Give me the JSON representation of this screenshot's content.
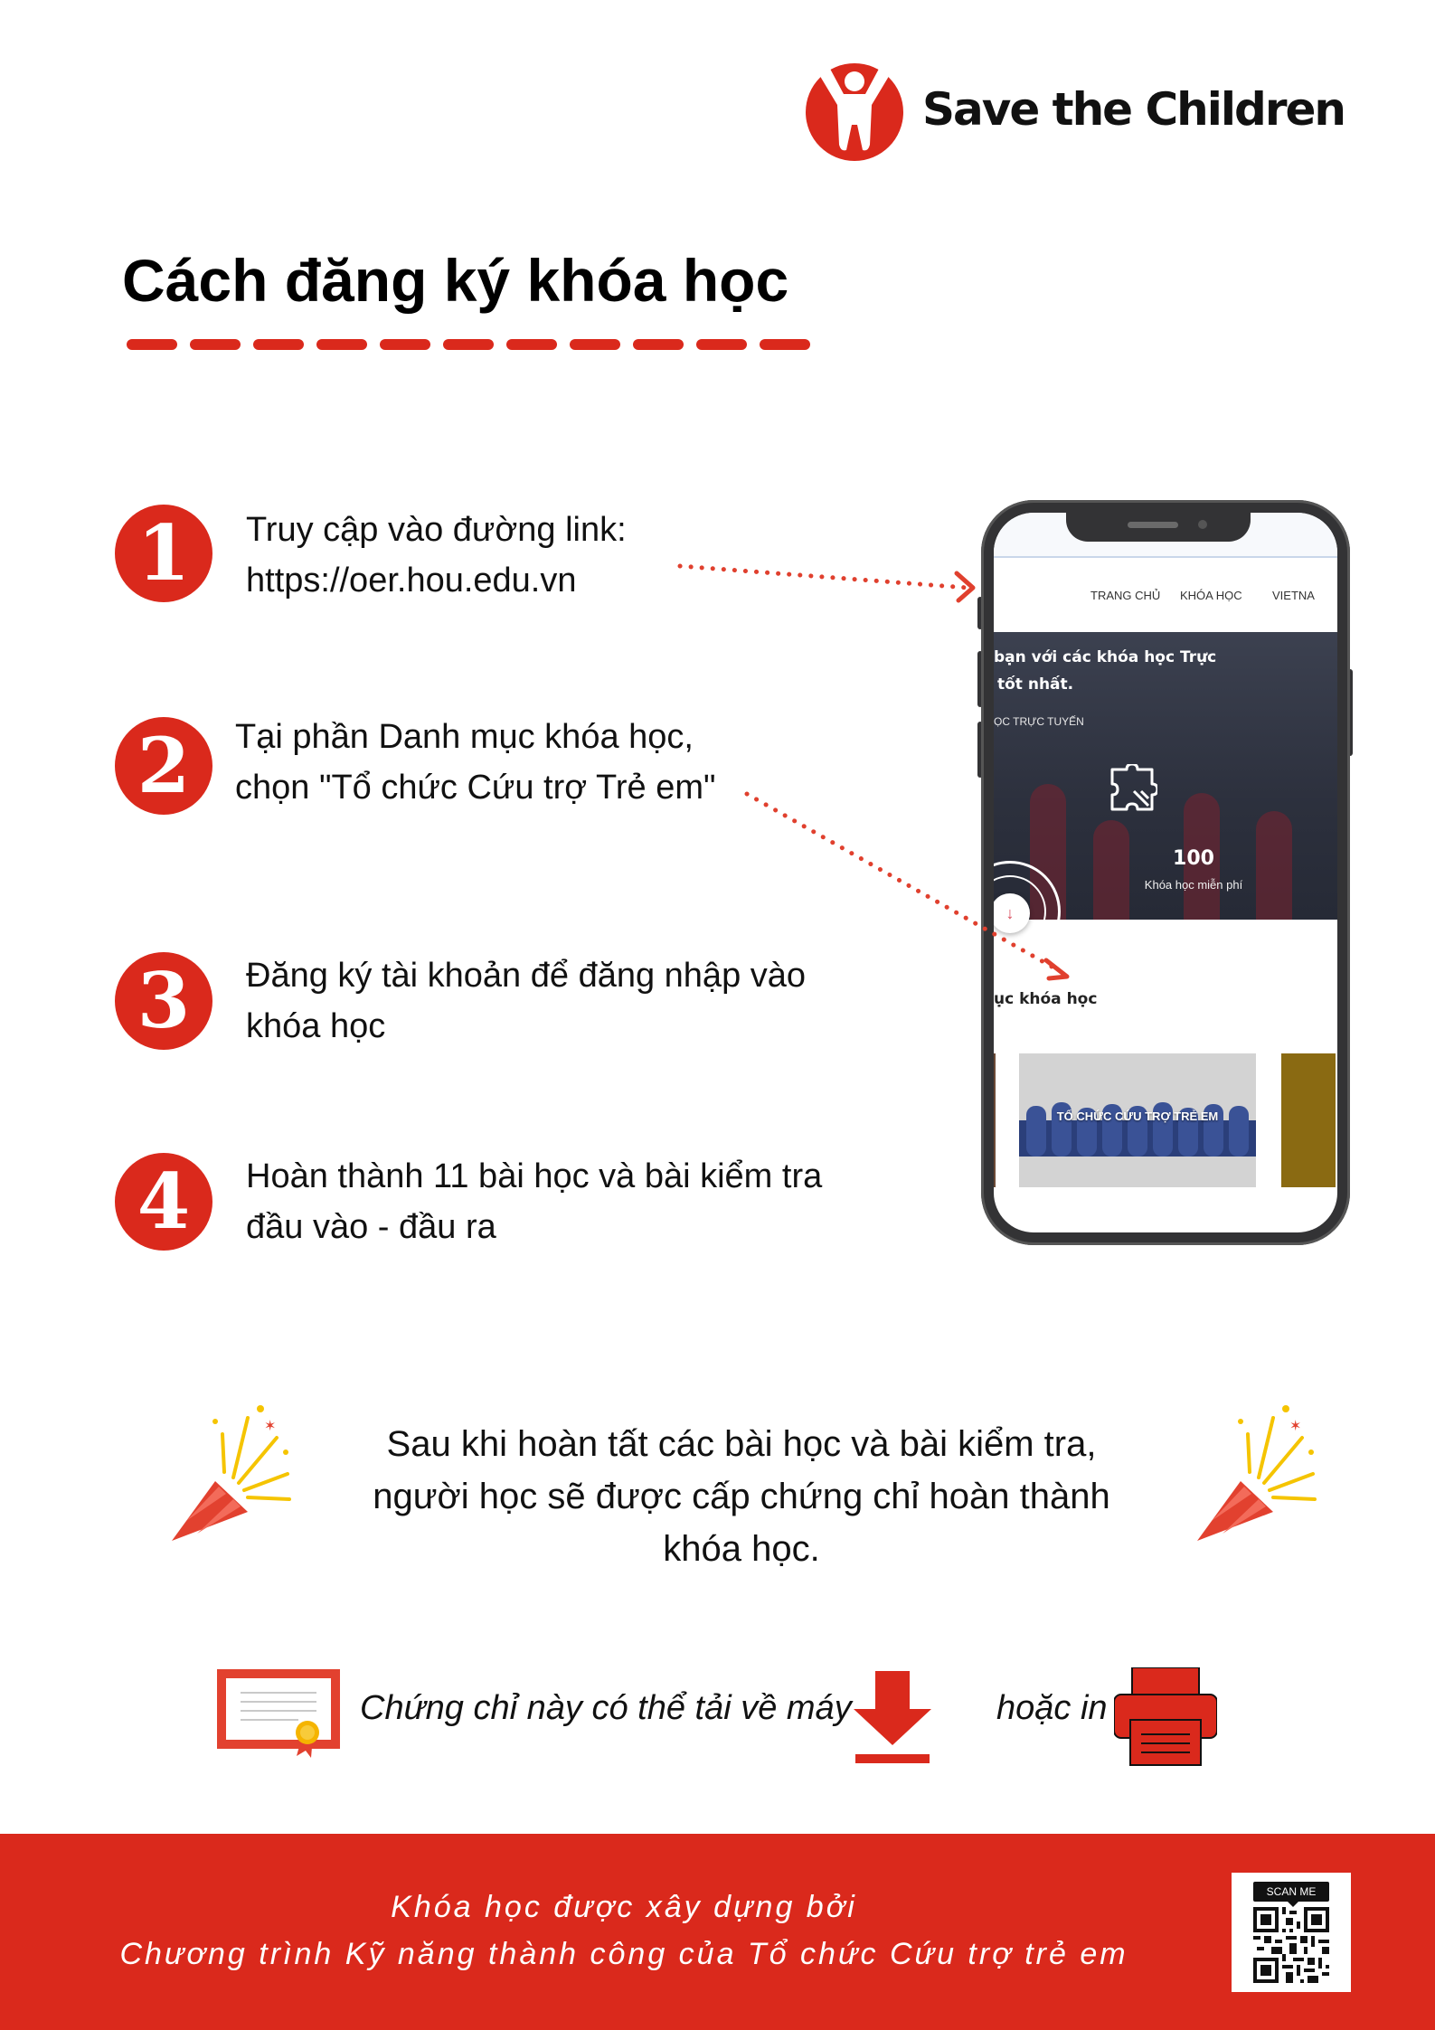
{
  "brand": {
    "name": "Save the Children",
    "color": "#da291c"
  },
  "title": "Cách đăng ký khóa học",
  "steps": [
    {
      "number": "1",
      "lines": [
        "Truy cập vào đường link:",
        "https://oer.hou.edu.vn"
      ]
    },
    {
      "number": "2",
      "lines": [
        "Tại phần Danh mục khóa học,",
        "chọn \"Tổ chức Cứu trợ Trẻ em\""
      ]
    },
    {
      "number": "3",
      "lines": [
        "Đăng ký tài khoản để đăng nhập vào",
        "khóa học"
      ]
    },
    {
      "number": "4",
      "lines": [
        "Hoàn thành 11 bài học và bài kiểm tra",
        "đầu vào - đầu ra"
      ]
    }
  ],
  "phone": {
    "nav": [
      "TRANG CHỦ",
      "KHÓA HỌC",
      "VIETNA"
    ],
    "hero_line1": "bạn với các khóa học Trực",
    "hero_line2": "tốt nhất.",
    "hero_sub": "ỌC TRỰC TUYẾN",
    "stat_value": "100",
    "stat_label": "Khóa học miễn phí",
    "scroll_arrow": "↓",
    "category_title": "ục khóa học",
    "card_label": "TỔ CHỨC CỨU TRỢ TRẺ EM"
  },
  "completion": {
    "lines": [
      "Sau khi hoàn tất các bài học và bài kiểm tra,",
      "người học sẽ được cấp chứng chỉ hoàn thành",
      "khóa học."
    ]
  },
  "download": {
    "text": "Chứng chỉ này có thể tải về máy",
    "print_text": "hoặc in"
  },
  "footer": {
    "line1": "Khóa học được xây dựng bởi",
    "line2": "Chương trình Kỹ năng thành công của Tổ chức Cứu trợ trẻ em",
    "qr_label": "SCAN ME"
  },
  "icons": [
    "logo-icon",
    "certificate-icon",
    "download-icon",
    "printer-icon",
    "party-popper-icon",
    "qr-code-icon",
    "puzzle-icon"
  ]
}
